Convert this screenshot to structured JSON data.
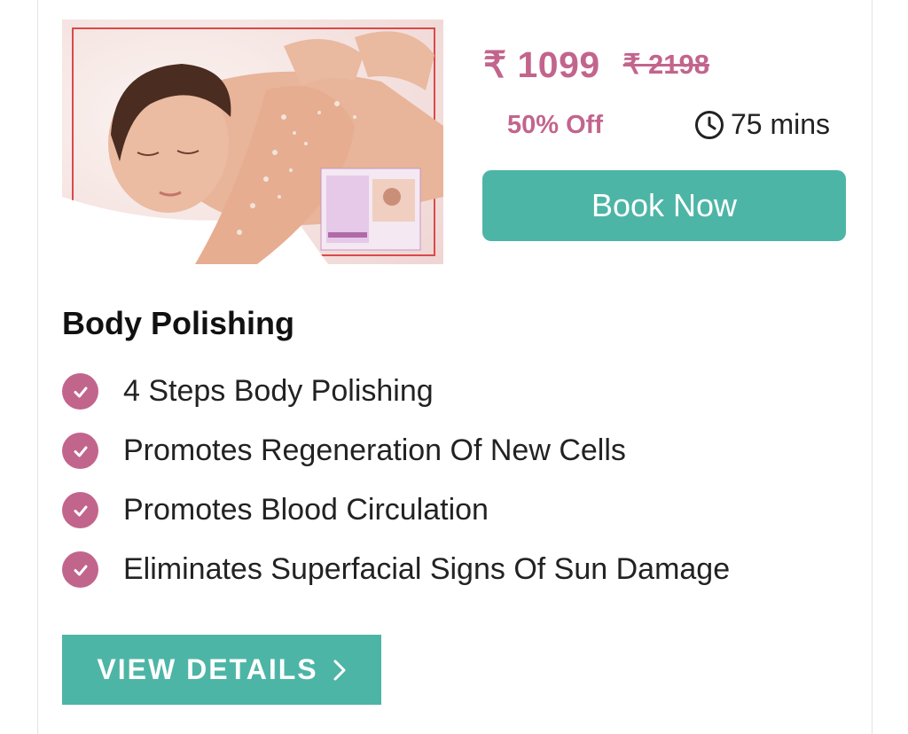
{
  "product": {
    "image_alt": "Body polishing massage",
    "price_current": "₹ 1099",
    "price_original": "₹ 2198",
    "discount": "50% Off",
    "duration": "75 mins",
    "book_label": "Book Now",
    "title": "Body Polishing",
    "features": [
      "4 Steps Body Polishing",
      "Promotes Regeneration Of New Cells",
      "Promotes Blood Circulation",
      "Eliminates Superfacial Signs Of Sun Damage"
    ],
    "details_label": "VIEW DETAILS"
  },
  "icons": {
    "clock": "clock-icon",
    "check": "check-circle-icon",
    "chevron": "chevron-right-icon"
  },
  "colors": {
    "accent_pink": "#c2658d",
    "teal": "#4db5a6"
  }
}
